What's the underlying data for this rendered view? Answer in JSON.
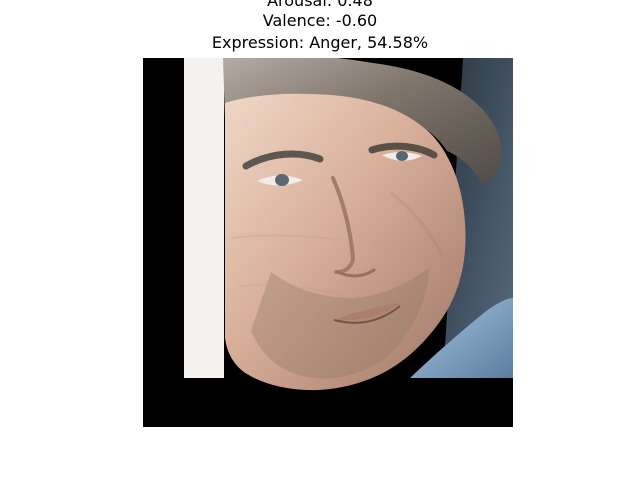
{
  "title": {
    "arousal": "Arousal: 0.48",
    "valence": "Valence: -0.60",
    "expression": "Expression: Anger, 54.58%"
  },
  "image": {
    "subject": "face-photo",
    "colors": {
      "border": "#000000",
      "left_strip": "#f4f1ef",
      "skin": "#d9b4a0",
      "hair": "#8f8579",
      "jacket": "#7fa3c3"
    }
  }
}
